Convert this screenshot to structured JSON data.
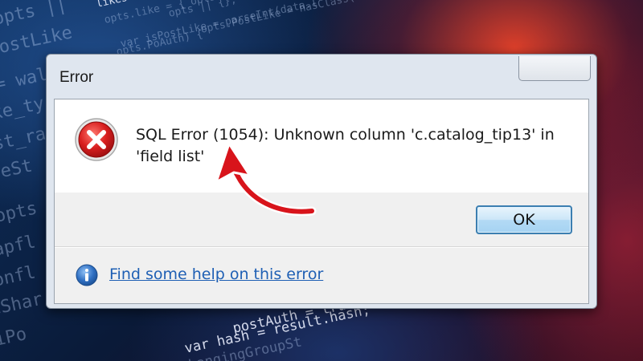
{
  "background": {
    "code_left": [
      "opts ||",
      "PostLike",
      "= wal",
      "ke_ty",
      "st_ra",
      "peSt",
      "opts",
      "apfl",
      "onfl",
      "eShar",
      "iPo"
    ],
    "code_top": [
      "likes",
      "opts.PostLike = hasClass(",
      "var isPostLike = parseInt(data.l",
      "opts.PoAuth) {",
      "opts || {};",
      "opts.like = { opts.id"
    ],
    "code_bottom": [
      "postAuth = true;",
      "var hash = result.hash;",
      "changingGroupSt"
    ]
  },
  "dialog": {
    "title": "Error",
    "icon": "error-icon",
    "message": "SQL Error (1054): Unknown column 'c.catalog_tip13' in 'field list'",
    "ok_label": "OK",
    "help_icon": "info-icon",
    "help_link": "Find some help on this error"
  },
  "annotation": {
    "icon": "red-arrow-icon",
    "color": "#d8141b"
  },
  "colors": {
    "link": "#1e5fb4",
    "error_red": "#c8161d",
    "info_blue": "#2f6fc2",
    "ok_border": "#3c7fb1"
  }
}
